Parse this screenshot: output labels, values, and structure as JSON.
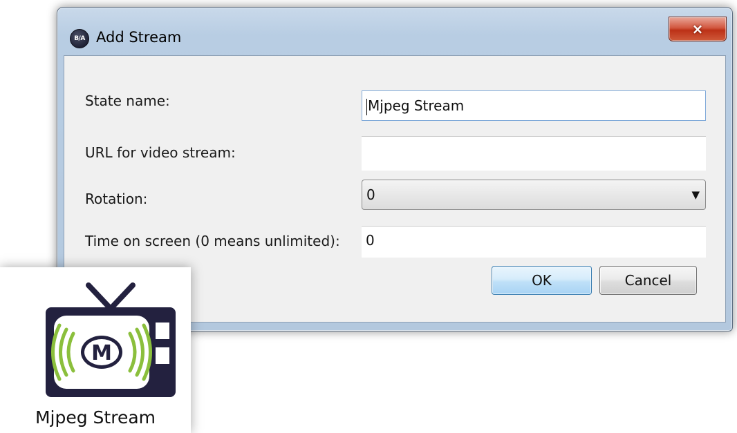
{
  "window": {
    "title": "Add Stream",
    "app_icon_text": "B/A",
    "close_glyph": "×"
  },
  "form": {
    "state_name_label": "State name:",
    "state_name_value": "Mjpeg Stream",
    "url_label": "URL for video stream:",
    "url_value": "",
    "rotation_label": "Rotation:",
    "rotation_value": "0",
    "time_label": "Time on screen (0 means unlimited):",
    "time_value": "0"
  },
  "buttons": {
    "ok_label": "OK",
    "cancel_label": "Cancel"
  },
  "desktop_icon": {
    "label": "Mjpeg Stream",
    "icon_letter": "M",
    "icon_name": "tv-broadcast-icon",
    "colors": {
      "screen_frame": "#23213f",
      "screen_fill": "#ffffff",
      "waves": "#8bbf3c",
      "letter": "#23213f"
    }
  }
}
